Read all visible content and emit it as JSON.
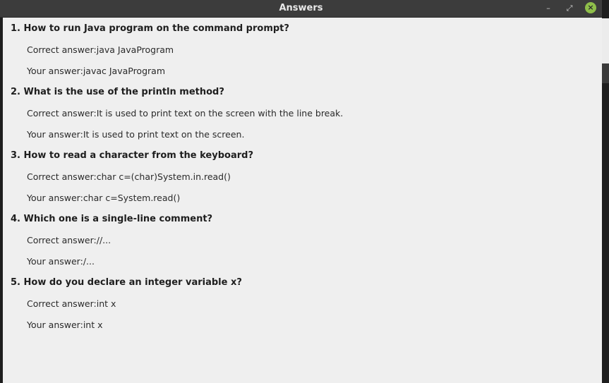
{
  "window": {
    "title": "Answers",
    "minimize_glyph": "–",
    "maximize_glyph": "⤢",
    "close_glyph": "×"
  },
  "questions": [
    {
      "question": "1. How to run Java program on the command prompt?",
      "correct_label": "Correct answer:",
      "correct": "java JavaProgram",
      "yours_label": "Your answer:",
      "yours": "javac JavaProgram"
    },
    {
      "question": "2. What is the use of the println method?",
      "correct_label": "Correct answer:",
      "correct": "It is used to print text on the screen with the line break.",
      "yours_label": "Your answer:",
      "yours": "It is used to print text on the screen."
    },
    {
      "question": "3. How to read a character from the keyboard?",
      "correct_label": "Correct answer:",
      "correct": "char c=(char)System.in.read()",
      "yours_label": "Your answer:",
      "yours": "char c=System.read()"
    },
    {
      "question": "4. Which one is a single-line comment?",
      "correct_label": "Correct answer:",
      "correct": "//...",
      "yours_label": "Your answer:",
      "yours": "/..."
    },
    {
      "question": "5. How do you declare an integer variable x?",
      "correct_label": "Correct answer:",
      "correct": "int x",
      "yours_label": "Your answer:",
      "yours": "int x"
    }
  ]
}
